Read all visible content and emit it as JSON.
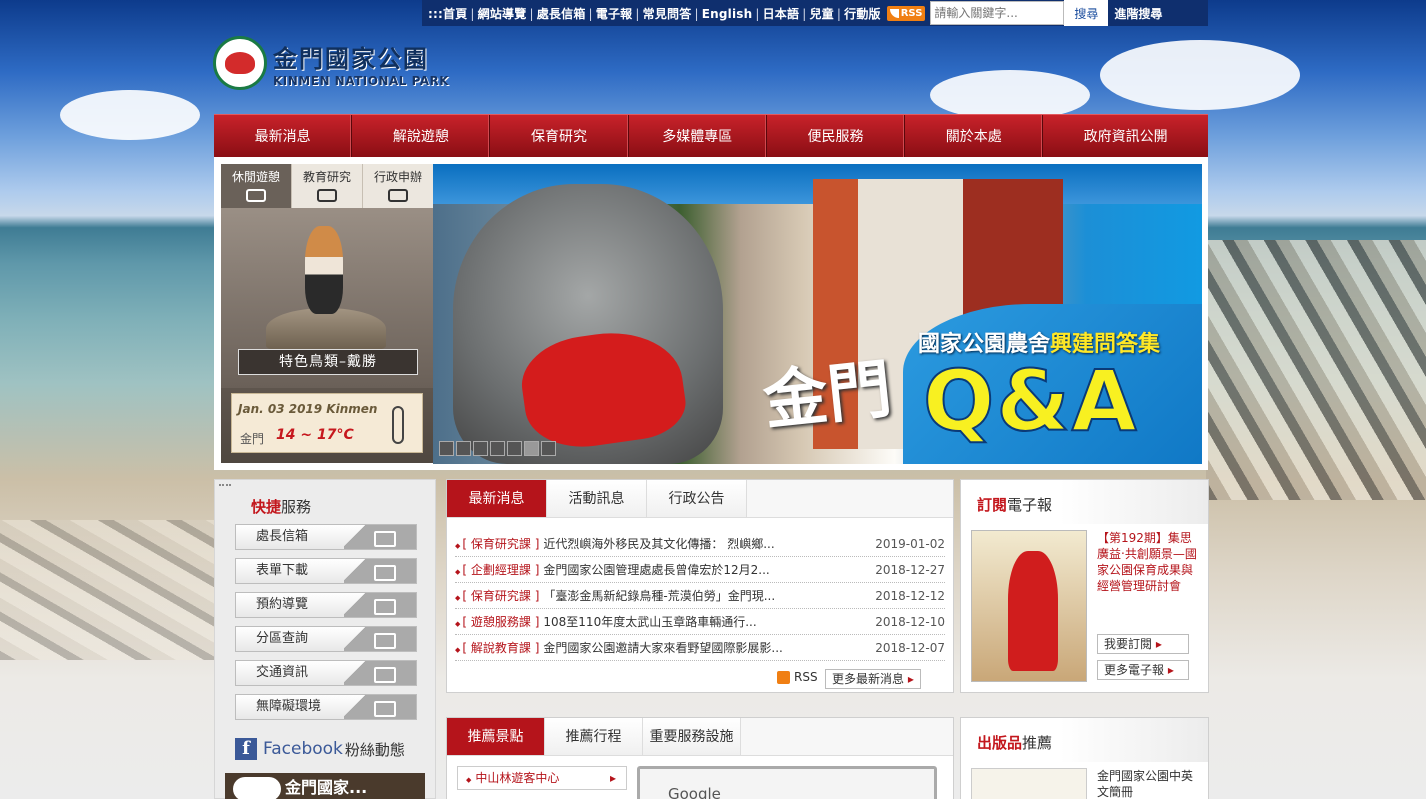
{
  "topbar": {
    "links": [
      ":::首頁",
      "網站導覽",
      "處長信箱",
      "電子報",
      "常見問答",
      "English",
      "日本語",
      "兒童",
      "行動版"
    ],
    "rss": "RSS",
    "search_placeholder": "請輸入關鍵字...",
    "search_btn": "搜尋",
    "advanced": "進階搜尋"
  },
  "logo": {
    "zh": "金門國家公園",
    "en": "KINMEN NATIONAL PARK"
  },
  "nav": [
    "最新消息",
    "解說遊憩",
    "保育研究",
    "多媒體專區",
    "便民服務",
    "關於本處",
    "政府資訊公開"
  ],
  "sidebar": {
    "tabs": [
      "休閒遊憩",
      "教育研究",
      "行政申辦"
    ],
    "bird_label": "特色鳥類–戴勝",
    "date": "Jan. 03 2019 Kinmen",
    "city": "金門",
    "temp": "14 ~ 17°C"
  },
  "banner": {
    "line1a": "國家公園農舍",
    "line1b": "興建問答集",
    "line2": "金門",
    "line3": "Q&A",
    "slides": 7,
    "active_slide": 6
  },
  "quick": {
    "title_a": "快捷",
    "title_b": "服務",
    "items": [
      "處長信箱",
      "表單下載",
      "預約導覽",
      "分區查詢",
      "交通資訊",
      "無障礙環境"
    ],
    "facebook": "Facebook",
    "facebook_sub": "粉絲動態",
    "fb_bar": "金門國家..."
  },
  "news": {
    "tabs": [
      "最新消息",
      "活動訊息",
      "行政公告"
    ],
    "rows": [
      {
        "cat": "[ 保育研究課 ]",
        "title": "近代烈嶼海外移民及其文化傳播： 烈嶼鄉...",
        "date": "2019-01-02"
      },
      {
        "cat": "[ 企劃經理課 ]",
        "title": "金門國家公園管理處處長曾偉宏於12月2...",
        "date": "2018-12-27"
      },
      {
        "cat": "[ 保育研究課 ]",
        "title": "「臺澎金馬新紀錄鳥種-荒漠伯勞」金門現...",
        "date": "2018-12-12"
      },
      {
        "cat": "[ 遊憩服務課 ]",
        "title": "108至110年度太武山玉章路車輛通行...",
        "date": "2018-12-10"
      },
      {
        "cat": "[ 解說教育課 ]",
        "title": "金門國家公園邀請大家來看野望國際影展影...",
        "date": "2018-12-07"
      }
    ],
    "rss": "RSS",
    "more": "更多最新消息"
  },
  "epaper": {
    "title_a": "訂閱",
    "title_b": "電子報",
    "issue": "【第192期】集思廣益‧共創願景—國家公園保育成果與經營管理研討會",
    "subscribe": "我要訂閱",
    "more": "更多電子報"
  },
  "recommend": {
    "tabs": [
      "推薦景點",
      "推薦行程",
      "重要服務設施"
    ],
    "link": "中山林遊客中心",
    "map_label": "Google"
  },
  "publication": {
    "title_a": "出版品",
    "title_b": "推薦",
    "item": "金門國家公園中英文簡冊"
  }
}
